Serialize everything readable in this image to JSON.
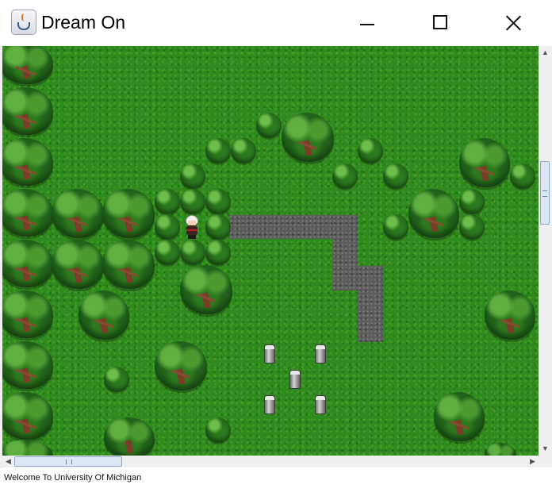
{
  "window": {
    "title": "Dream On"
  },
  "controls": {
    "minimize_icon": "minimize-icon",
    "maximize_icon": "maximize-icon",
    "close_icon": "close-icon"
  },
  "status": {
    "message": "Welcome To University Of Michigan"
  },
  "colors": {
    "grass": "#2f8a1e",
    "path": "#5c5c5c",
    "tree_foliage": "#21631a",
    "trunk": "#7a3d2a"
  },
  "scroll": {
    "vertical_position": 0.28,
    "horizontal_position": 0.0
  }
}
